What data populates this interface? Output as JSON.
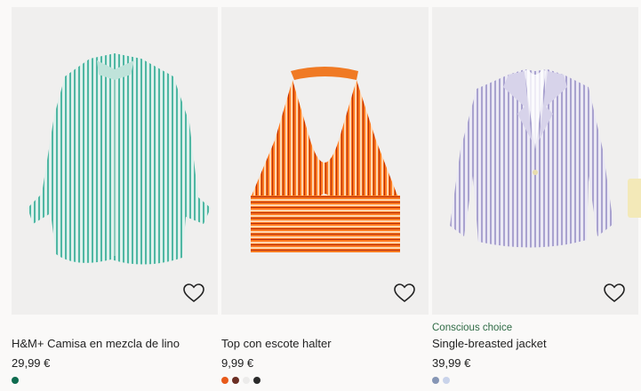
{
  "products": [
    {
      "tag": "",
      "title": "H&M+ Camisa en mezcla de lino",
      "price": "29,99 €",
      "image_icon": "striped-linen-shirt",
      "swatches": [
        "#0f6b4f"
      ]
    },
    {
      "tag": "",
      "title": "Top con escote halter",
      "price": "9,99 €",
      "image_icon": "striped-halter-top",
      "swatches": [
        "#e85a1a",
        "#6b2e23",
        "#ecebea",
        "#2a2a2a"
      ]
    },
    {
      "tag": "Conscious choice",
      "title": "Single-breasted jacket",
      "price": "39,99 €",
      "image_icon": "striped-blazer",
      "swatches": [
        "#8696b5",
        "#c9d3ea"
      ]
    }
  ],
  "colors": {
    "tag": "#2f6b45",
    "image_bg": "#f0efee",
    "page_bg": "#faf9f8"
  },
  "icons": {
    "favorite": "heart-outline-icon"
  }
}
